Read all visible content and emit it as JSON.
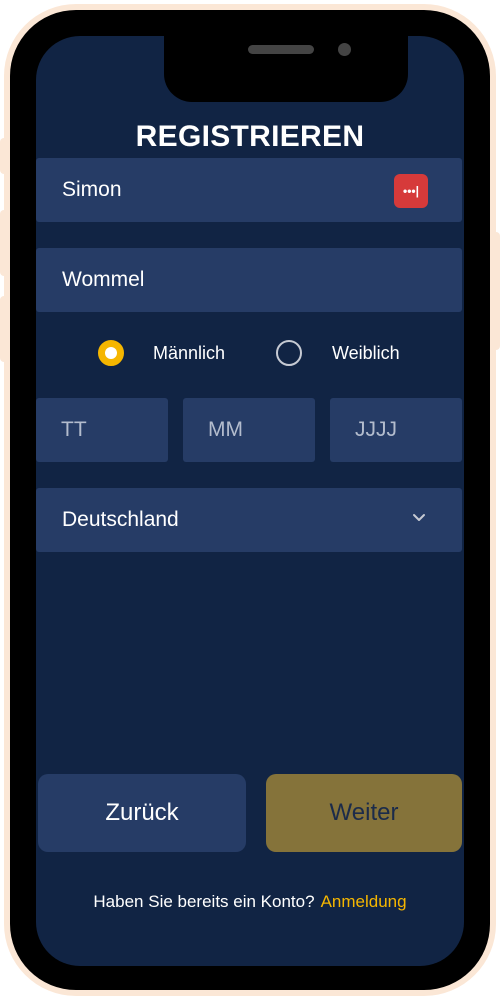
{
  "title": "REGISTRIEREN",
  "form": {
    "first_name_value": "Simon",
    "last_name_value": "Wommel",
    "gender": {
      "options": [
        {
          "label": "Männlich",
          "selected": true
        },
        {
          "label": "Weiblich",
          "selected": false
        }
      ]
    },
    "birthdate": {
      "day_placeholder": "TT",
      "month_placeholder": "MM",
      "year_placeholder": "JJJJ"
    },
    "country": "Deutschland",
    "password_manager_icon_text": "•••|"
  },
  "buttons": {
    "back_label": "Zurück",
    "next_label": "Weiter"
  },
  "footer": {
    "prompt": "Haben Sie bereits ein Konto?",
    "login_link": "Anmeldung"
  },
  "colors": {
    "screen_bg": "#112444",
    "field_bg": "#263c66",
    "accent": "#f5b600",
    "next_button_bg": "#85733a"
  }
}
